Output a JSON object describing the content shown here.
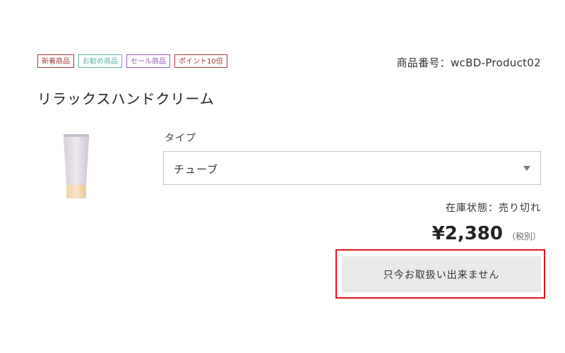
{
  "badges": [
    {
      "label": "新着商品",
      "color": "#a33a3a"
    },
    {
      "label": "お勧め商品",
      "color": "#5fb3a6"
    },
    {
      "label": "セール商品",
      "color": "#9b59b6"
    },
    {
      "label": "ポイント10倍",
      "color": "#a33a3a"
    }
  ],
  "product": {
    "number_label": "商品番号：wcBD-Product02",
    "title": "リラックスハンドクリーム",
    "image_icon": "hand-cream-tube"
  },
  "option": {
    "label": "タイプ",
    "selected": "チューブ"
  },
  "stock_status": "在庫状態：売り切れ",
  "price": {
    "amount": "¥2,380",
    "tax_note": "（税別）"
  },
  "action": {
    "button_label": "只今お取扱い出来ません",
    "highlight_color": "#e0141e"
  }
}
